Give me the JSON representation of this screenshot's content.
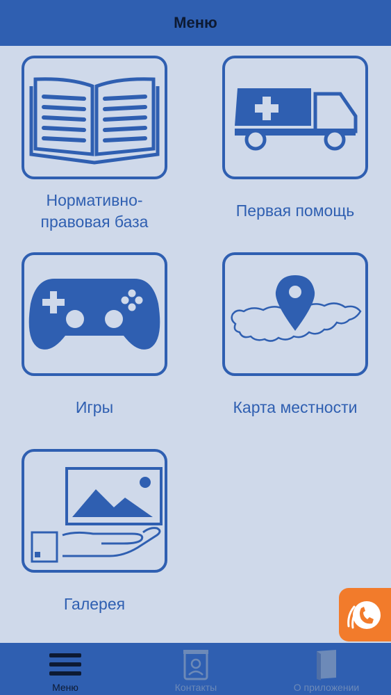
{
  "header": {
    "title": "Меню"
  },
  "menu": {
    "items": [
      {
        "label": "Нормативно-\nправовая база",
        "icon": "book-icon"
      },
      {
        "label": "Первая помощь",
        "icon": "ambulance-icon"
      },
      {
        "label": "Игры",
        "icon": "gamepad-icon"
      },
      {
        "label": "Карта местности",
        "icon": "map-pin-icon"
      },
      {
        "label": "Галерея",
        "icon": "gallery-hand-icon"
      }
    ]
  },
  "fab": {
    "icon": "phone-call-icon"
  },
  "tabbar": {
    "tabs": [
      {
        "label": "Меню",
        "icon": "hamburger-icon",
        "active": true
      },
      {
        "label": "Контакты",
        "icon": "contact-card-icon",
        "active": false
      },
      {
        "label": "О приложении",
        "icon": "info-book-icon",
        "active": false
      }
    ]
  },
  "colors": {
    "primary": "#2f5fb1",
    "background": "#cfd9ea",
    "fab": "#f27b2b",
    "tab_active": "#0d1a33",
    "tab_inactive": "#6d8ab8"
  }
}
